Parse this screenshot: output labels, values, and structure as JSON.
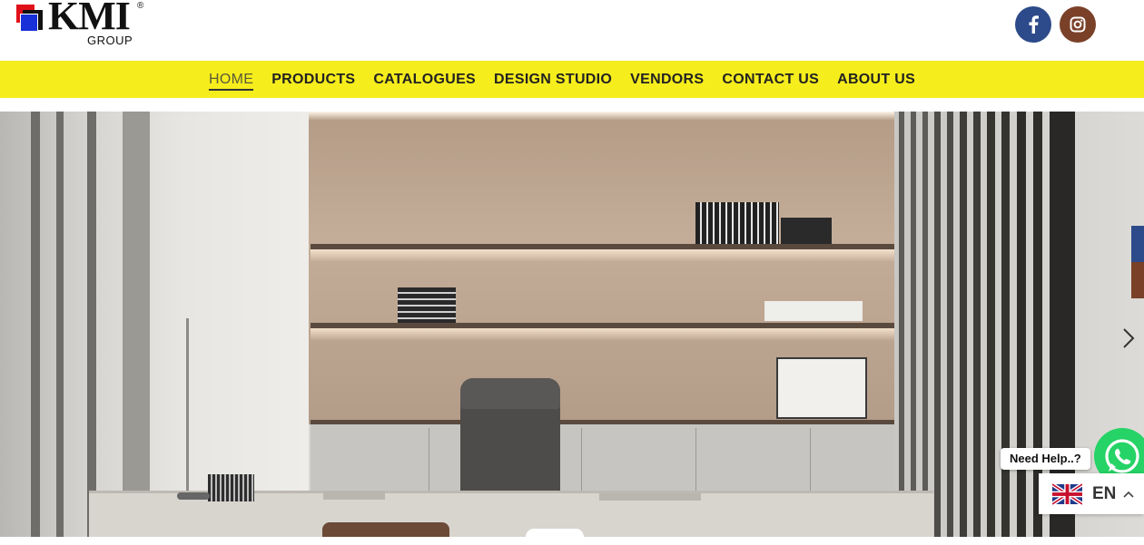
{
  "header": {
    "logo": {
      "brand": "KMI",
      "registered": "®",
      "subtitle": "GROUP"
    },
    "social": [
      {
        "name": "facebook",
        "icon": "facebook-icon",
        "color": "#2d4a8a"
      },
      {
        "name": "instagram",
        "icon": "instagram-icon",
        "color": "#7a4028"
      }
    ]
  },
  "nav": {
    "background": "#f6ed1c",
    "items": [
      {
        "label": "HOME",
        "active": true
      },
      {
        "label": "PRODUCTS",
        "active": false
      },
      {
        "label": "CATALOGUES",
        "active": false
      },
      {
        "label": "DESIGN STUDIO",
        "active": false
      },
      {
        "label": "VENDORS",
        "active": false
      },
      {
        "label": "CONTACT US",
        "active": false
      },
      {
        "label": "ABOUT US",
        "active": false
      }
    ]
  },
  "hero": {
    "subject": "office interior slide",
    "next_icon": "chevron-right-icon"
  },
  "widgets": {
    "help_label": "Need Help..?",
    "whatsapp_icon": "whatsapp-icon",
    "whatsapp_color": "#25d366",
    "language": {
      "code": "EN",
      "flag_icon": "uk-flag-icon",
      "caret_icon": "chevron-up-icon"
    }
  }
}
